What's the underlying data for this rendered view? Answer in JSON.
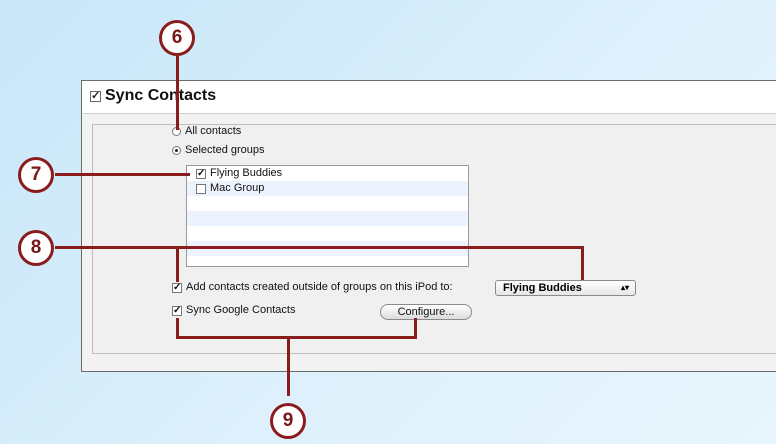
{
  "panel": {
    "title": "Sync Contacts",
    "sync_checked": true,
    "radio_all": "All contacts",
    "radio_selected": "Selected groups",
    "selected_radio": "selected"
  },
  "groups": [
    {
      "label": "Flying Buddies",
      "checked": true
    },
    {
      "label": "Mac Group",
      "checked": false
    }
  ],
  "options": {
    "add_outside_label": "Add contacts created outside of groups on this iPod to:",
    "add_outside_checked": true,
    "target_group": "Flying Buddies",
    "google_label": "Sync Google Contacts",
    "google_checked": true,
    "configure_label": "Configure..."
  },
  "callouts": {
    "c6": "6",
    "c7": "7",
    "c8": "8",
    "c9": "9"
  },
  "colors": {
    "callout": "#8b1c1c"
  }
}
